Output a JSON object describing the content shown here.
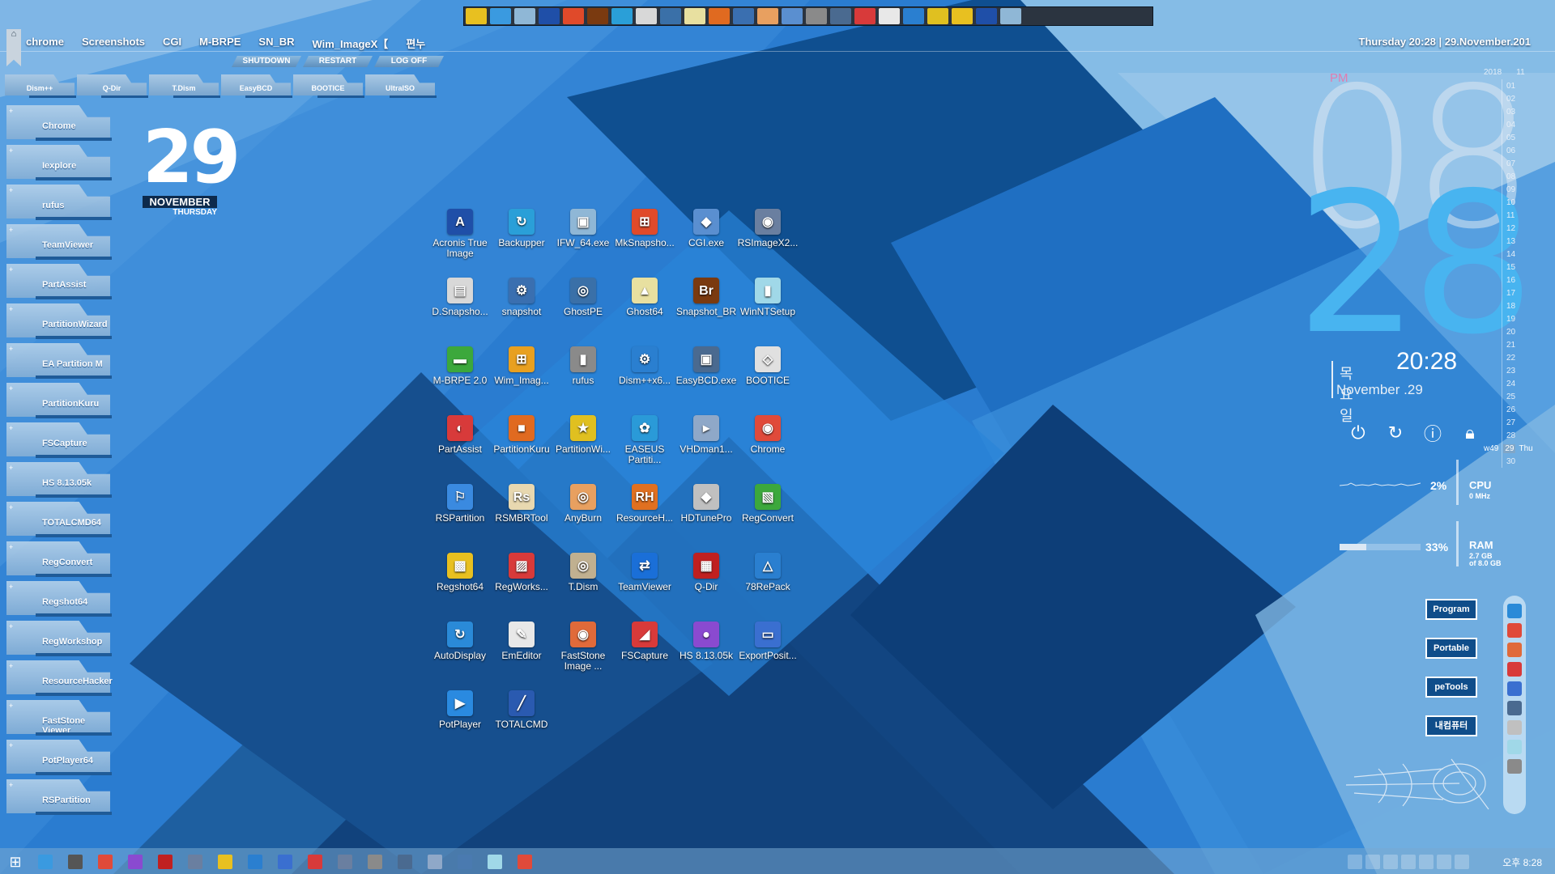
{
  "colors": {
    "accent": "#48b4f0",
    "pm": "#e07cb0",
    "panel": "#0f4d8a"
  },
  "quicklaunch": [
    "app-icon",
    "partition-icon",
    "tool-icon",
    "acronis-icon",
    "windows-icon",
    "bridge-icon",
    "disk-icon",
    "screen-icon",
    "ghost-icon",
    "wand-icon",
    "archive-icon",
    "snapshot-icon",
    "burn-icon",
    "search-icon",
    "gear-icon",
    "drive-icon",
    "fire-icon",
    "pen-icon",
    "tool2-icon",
    "flower-icon",
    "rs-icon",
    "acronis2-icon",
    "image-icon"
  ],
  "topmenu": [
    "chrome",
    "Screenshots",
    "CGI",
    "M-BRPE",
    "SN_BR",
    "Wim_ImageX【",
    "편누"
  ],
  "clockline": "Thursday 20:28 | 29.November.201",
  "power": [
    "SHUTDOWN",
    "RESTART",
    "LOG OFF"
  ],
  "tools": [
    "Dism++",
    "Q-Dir",
    "T.Dism",
    "EasyBCD",
    "BOOTICE",
    "UltraISO"
  ],
  "sidebar": [
    "Chrome",
    "Iexplore",
    "rufus",
    "TeamViewer",
    "PartAssist",
    "PartitionWizard",
    "EA Partition M",
    "PartitionKuru",
    "FSCapture",
    "HS 8.13.05k",
    "TOTALCMD64",
    "RegConvert",
    "Regshot64",
    "RegWorkshop",
    "ResourceHacker",
    "FastStone Viewer",
    "PotPlayer64",
    "RSPartition"
  ],
  "date": {
    "day": "29",
    "month": "NOVEMBER",
    "weekday": "THURSDAY"
  },
  "desktop_icons": [
    {
      "label": "Acronis True Image",
      "glyph": "A",
      "color": "#1f4fa8",
      "icon": "acronis-icon"
    },
    {
      "label": "Backupper",
      "glyph": "↻",
      "color": "#2a9fd8",
      "icon": "backup-icon"
    },
    {
      "label": "IFW_64.exe",
      "glyph": "▣",
      "color": "#8fb7d6",
      "icon": "image-icon"
    },
    {
      "label": "MkSnapsho...",
      "glyph": "⊞",
      "color": "#e04a2a",
      "icon": "windows-icon"
    },
    {
      "label": "CGI.exe",
      "glyph": "◆",
      "color": "#5a8fd0",
      "icon": "cgi-icon"
    },
    {
      "label": "RSImageX2...",
      "glyph": "◉",
      "color": "#6a7fa0",
      "icon": "rsimage-icon"
    },
    {
      "label": "D.Snapsho...",
      "glyph": "▤",
      "color": "#d8d8d8",
      "icon": "drive-icon"
    },
    {
      "label": "snapshot",
      "glyph": "⚙",
      "color": "#3a6fb0",
      "icon": "snapshot-icon"
    },
    {
      "label": "GhostPE",
      "glyph": "◎",
      "color": "#3a70a8",
      "icon": "ghostpe-icon"
    },
    {
      "label": "Ghost64",
      "glyph": "▲",
      "color": "#e8e0a0",
      "icon": "ghost-icon"
    },
    {
      "label": "Snapshot_BR",
      "glyph": "Br",
      "color": "#7a3a10",
      "icon": "bridge-icon"
    },
    {
      "label": "WinNTSetup",
      "glyph": "▮",
      "color": "#a0d8e8",
      "icon": "setup-icon"
    },
    {
      "label": "M-BRPE 2.0",
      "glyph": "▬",
      "color": "#3ca83c",
      "icon": "mbrpe-icon"
    },
    {
      "label": "Wim_Imag...",
      "glyph": "⊞",
      "color": "#e8a020",
      "icon": "windows2-icon"
    },
    {
      "label": "rufus",
      "glyph": "▮",
      "color": "#8a8a8a",
      "icon": "usb-icon"
    },
    {
      "label": "Dism++x6...",
      "glyph": "⚙",
      "color": "#2a7fd0",
      "icon": "gear-icon"
    },
    {
      "label": "EasyBCD.exe",
      "glyph": "▣",
      "color": "#4a6a90",
      "icon": "easybcd-icon"
    },
    {
      "label": "BOOTICE",
      "glyph": "◇",
      "color": "#e0e0e0",
      "icon": "bootice-icon"
    },
    {
      "label": "PartAssist",
      "glyph": "◐",
      "color": "#d83a3a",
      "icon": "partassist-icon"
    },
    {
      "label": "PartitionKuru",
      "glyph": "■",
      "color": "#e06a20",
      "icon": "partkuru-icon"
    },
    {
      "label": "PartitionWi...",
      "glyph": "★",
      "color": "#e0c020",
      "icon": "partwizard-icon"
    },
    {
      "label": "EASEUS Partiti...",
      "glyph": "✿",
      "color": "#2a9ad8",
      "icon": "easeus-icon"
    },
    {
      "label": "VHDman1...",
      "glyph": "▸",
      "color": "#8fa8c8",
      "icon": "vhd-icon"
    },
    {
      "label": "Chrome",
      "glyph": "◉",
      "color": "#e04a3a",
      "icon": "chrome-icon"
    },
    {
      "label": "RSPartition",
      "glyph": "⚐",
      "color": "#3a8ae0",
      "icon": "rspartition-icon"
    },
    {
      "label": "RSMBRTool",
      "glyph": "Rs",
      "color": "#e8d8b0",
      "icon": "rsmbr-icon"
    },
    {
      "label": "AnyBurn",
      "glyph": "◎",
      "color": "#e8a060",
      "icon": "burn-icon"
    },
    {
      "label": "ResourceH...",
      "glyph": "RH",
      "color": "#e07020",
      "icon": "reshacker-icon"
    },
    {
      "label": "HDTunePro",
      "glyph": "◆",
      "color": "#c0c0c0",
      "icon": "hdtune-icon"
    },
    {
      "label": "RegConvert",
      "glyph": "▧",
      "color": "#3ca83c",
      "icon": "regconvert-icon"
    },
    {
      "label": "Regshot64",
      "glyph": "▩",
      "color": "#e8c020",
      "icon": "regshot-icon"
    },
    {
      "label": "RegWorks...",
      "glyph": "▨",
      "color": "#d83a3a",
      "icon": "regworks-icon"
    },
    {
      "label": "T.Dism",
      "glyph": "◎",
      "color": "#c0b090",
      "icon": "tdism-icon"
    },
    {
      "label": "TeamViewer",
      "glyph": "⇄",
      "color": "#1a6fd8",
      "icon": "teamviewer-icon"
    },
    {
      "label": "Q-Dir",
      "glyph": "▦",
      "color": "#c02020",
      "icon": "qdir-icon"
    },
    {
      "label": "78RePack",
      "glyph": "△",
      "color": "#2a7fd0",
      "icon": "repack-icon"
    },
    {
      "label": "AutoDisplay",
      "glyph": "↻",
      "color": "#2a8ad8",
      "icon": "autodisplay-icon"
    },
    {
      "label": "EmEditor",
      "glyph": "✎",
      "color": "#e8e8e8",
      "icon": "emeditor-icon"
    },
    {
      "label": "FastStone Image ...",
      "glyph": "◉",
      "color": "#e06a3a",
      "icon": "faststone-icon"
    },
    {
      "label": "FSCapture",
      "glyph": "◢",
      "color": "#d83a3a",
      "icon": "fscapture-icon"
    },
    {
      "label": "HS 8.13.05k",
      "glyph": "●",
      "color": "#8a4ad0",
      "icon": "hs-icon"
    },
    {
      "label": "ExportPosit...",
      "glyph": "▭",
      "color": "#3a6fd0",
      "icon": "export-icon"
    },
    {
      "label": "PotPlayer",
      "glyph": "▶",
      "color": "#2a8ae0",
      "icon": "potplayer-icon"
    },
    {
      "label": "TOTALCMD",
      "glyph": "╱",
      "color": "#2a5ab0",
      "icon": "totalcmd-icon"
    }
  ],
  "clock": {
    "ampm": "PM",
    "hour": "08",
    "minute": "28",
    "korean_day": "목요일",
    "time": "20:28",
    "date": "November .29"
  },
  "calendar": {
    "year": "2018",
    "month": "11",
    "week": "w49",
    "highlight": "29",
    "weekday": "Thu",
    "days": [
      "01",
      "02",
      "03",
      "04",
      "05",
      "06",
      "07",
      "08",
      "09",
      "10",
      "11",
      "12",
      "13",
      "14",
      "15",
      "16",
      "17",
      "18",
      "19",
      "20",
      "21",
      "22",
      "23",
      "24",
      "25",
      "26",
      "27",
      "28",
      "29",
      "30"
    ]
  },
  "cpu": {
    "percent": "2%",
    "name": "CPU",
    "sub": "0 MHz",
    "level": 0.02
  },
  "ram": {
    "percent": "33%",
    "name": "RAM",
    "sub1": "2.7 GB",
    "sub2": "of 8.0 GB",
    "level": 0.33
  },
  "rightbuttons": [
    "Program",
    "Portable",
    "peTools",
    "내컴퓨터"
  ],
  "dock": [
    "ie-icon",
    "chrome-icon",
    "faststone-icon",
    "calendar-icon",
    "monitor-icon",
    "computer-icon",
    "eraser-icon",
    "book-icon",
    "usb-icon"
  ],
  "taskbar": [
    "start-icon",
    "cortana-icon",
    "settings-icon",
    "chrome-icon",
    "app-icon",
    "wrench-icon",
    "chevron-icon",
    "folder-icon",
    "cam-icon",
    "image-icon",
    "pin-icon",
    "capture-icon",
    "usb-icon",
    "tool-icon",
    "vhd-icon",
    "regedit-icon",
    "doc-icon",
    "chrome2-icon"
  ],
  "tray": {
    "time": "오후 8:28",
    "icons": [
      "network-icon",
      "drop-icon",
      "pen-icon",
      "color-icon",
      "volume-icon",
      "ime-icon",
      "keyboard-icon"
    ]
  }
}
